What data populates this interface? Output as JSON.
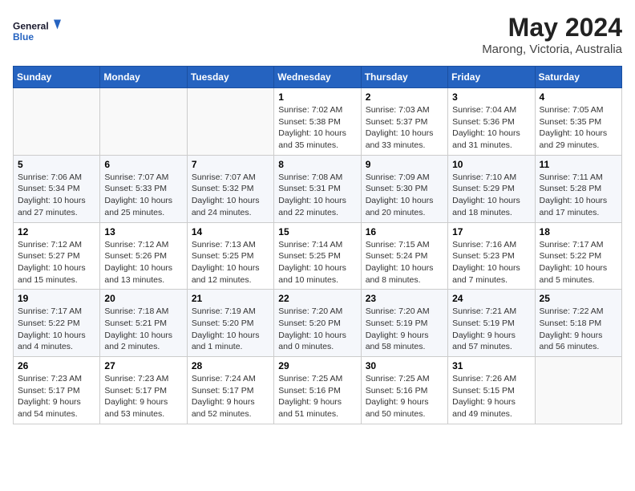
{
  "header": {
    "logo_line1": "General",
    "logo_line2": "Blue",
    "month_year": "May 2024",
    "location": "Marong, Victoria, Australia"
  },
  "days_of_week": [
    "Sunday",
    "Monday",
    "Tuesday",
    "Wednesday",
    "Thursday",
    "Friday",
    "Saturday"
  ],
  "weeks": [
    [
      {
        "day": "",
        "content": ""
      },
      {
        "day": "",
        "content": ""
      },
      {
        "day": "",
        "content": ""
      },
      {
        "day": "1",
        "content": "Sunrise: 7:02 AM\nSunset: 5:38 PM\nDaylight: 10 hours\nand 35 minutes."
      },
      {
        "day": "2",
        "content": "Sunrise: 7:03 AM\nSunset: 5:37 PM\nDaylight: 10 hours\nand 33 minutes."
      },
      {
        "day": "3",
        "content": "Sunrise: 7:04 AM\nSunset: 5:36 PM\nDaylight: 10 hours\nand 31 minutes."
      },
      {
        "day": "4",
        "content": "Sunrise: 7:05 AM\nSunset: 5:35 PM\nDaylight: 10 hours\nand 29 minutes."
      }
    ],
    [
      {
        "day": "5",
        "content": "Sunrise: 7:06 AM\nSunset: 5:34 PM\nDaylight: 10 hours\nand 27 minutes."
      },
      {
        "day": "6",
        "content": "Sunrise: 7:07 AM\nSunset: 5:33 PM\nDaylight: 10 hours\nand 25 minutes."
      },
      {
        "day": "7",
        "content": "Sunrise: 7:07 AM\nSunset: 5:32 PM\nDaylight: 10 hours\nand 24 minutes."
      },
      {
        "day": "8",
        "content": "Sunrise: 7:08 AM\nSunset: 5:31 PM\nDaylight: 10 hours\nand 22 minutes."
      },
      {
        "day": "9",
        "content": "Sunrise: 7:09 AM\nSunset: 5:30 PM\nDaylight: 10 hours\nand 20 minutes."
      },
      {
        "day": "10",
        "content": "Sunrise: 7:10 AM\nSunset: 5:29 PM\nDaylight: 10 hours\nand 18 minutes."
      },
      {
        "day": "11",
        "content": "Sunrise: 7:11 AM\nSunset: 5:28 PM\nDaylight: 10 hours\nand 17 minutes."
      }
    ],
    [
      {
        "day": "12",
        "content": "Sunrise: 7:12 AM\nSunset: 5:27 PM\nDaylight: 10 hours\nand 15 minutes."
      },
      {
        "day": "13",
        "content": "Sunrise: 7:12 AM\nSunset: 5:26 PM\nDaylight: 10 hours\nand 13 minutes."
      },
      {
        "day": "14",
        "content": "Sunrise: 7:13 AM\nSunset: 5:25 PM\nDaylight: 10 hours\nand 12 minutes."
      },
      {
        "day": "15",
        "content": "Sunrise: 7:14 AM\nSunset: 5:25 PM\nDaylight: 10 hours\nand 10 minutes."
      },
      {
        "day": "16",
        "content": "Sunrise: 7:15 AM\nSunset: 5:24 PM\nDaylight: 10 hours\nand 8 minutes."
      },
      {
        "day": "17",
        "content": "Sunrise: 7:16 AM\nSunset: 5:23 PM\nDaylight: 10 hours\nand 7 minutes."
      },
      {
        "day": "18",
        "content": "Sunrise: 7:17 AM\nSunset: 5:22 PM\nDaylight: 10 hours\nand 5 minutes."
      }
    ],
    [
      {
        "day": "19",
        "content": "Sunrise: 7:17 AM\nSunset: 5:22 PM\nDaylight: 10 hours\nand 4 minutes."
      },
      {
        "day": "20",
        "content": "Sunrise: 7:18 AM\nSunset: 5:21 PM\nDaylight: 10 hours\nand 2 minutes."
      },
      {
        "day": "21",
        "content": "Sunrise: 7:19 AM\nSunset: 5:20 PM\nDaylight: 10 hours\nand 1 minute."
      },
      {
        "day": "22",
        "content": "Sunrise: 7:20 AM\nSunset: 5:20 PM\nDaylight: 10 hours\nand 0 minutes."
      },
      {
        "day": "23",
        "content": "Sunrise: 7:20 AM\nSunset: 5:19 PM\nDaylight: 9 hours\nand 58 minutes."
      },
      {
        "day": "24",
        "content": "Sunrise: 7:21 AM\nSunset: 5:19 PM\nDaylight: 9 hours\nand 57 minutes."
      },
      {
        "day": "25",
        "content": "Sunrise: 7:22 AM\nSunset: 5:18 PM\nDaylight: 9 hours\nand 56 minutes."
      }
    ],
    [
      {
        "day": "26",
        "content": "Sunrise: 7:23 AM\nSunset: 5:17 PM\nDaylight: 9 hours\nand 54 minutes."
      },
      {
        "day": "27",
        "content": "Sunrise: 7:23 AM\nSunset: 5:17 PM\nDaylight: 9 hours\nand 53 minutes."
      },
      {
        "day": "28",
        "content": "Sunrise: 7:24 AM\nSunset: 5:17 PM\nDaylight: 9 hours\nand 52 minutes."
      },
      {
        "day": "29",
        "content": "Sunrise: 7:25 AM\nSunset: 5:16 PM\nDaylight: 9 hours\nand 51 minutes."
      },
      {
        "day": "30",
        "content": "Sunrise: 7:25 AM\nSunset: 5:16 PM\nDaylight: 9 hours\nand 50 minutes."
      },
      {
        "day": "31",
        "content": "Sunrise: 7:26 AM\nSunset: 5:15 PM\nDaylight: 9 hours\nand 49 minutes."
      },
      {
        "day": "",
        "content": ""
      }
    ]
  ]
}
